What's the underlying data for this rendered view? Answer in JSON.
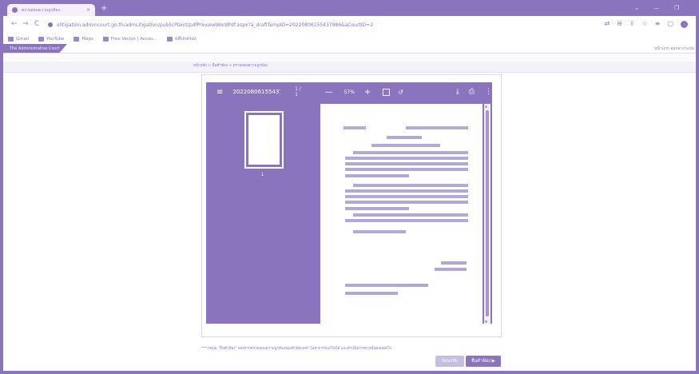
{
  "browser": {
    "tab_title": "ตรวจสอบความถูกต้อง",
    "tab_close": "×",
    "new_tab": "+",
    "minimize": "⌄",
    "min2": "—",
    "restore": "❐",
    "url": "elitigation.admincourt.go.th/admLitigation/publicPlaint/pdfPreviewWordPdf.aspx?a_draftTempID=20220806155437986&aCourtID=2",
    "back": "←",
    "forward": "→",
    "reload": "C",
    "icons": [
      "translate-icon",
      "zoom-icon",
      "share-icon",
      "star-icon",
      "reading-list-icon",
      "window-icon",
      "profile-icon"
    ]
  },
  "bookmarks": [
    {
      "label": "Gmail"
    },
    {
      "label": "YouTube"
    },
    {
      "label": "Maps"
    },
    {
      "label": "Free Vector | Accou..."
    },
    {
      "label": "คดีปกครอง"
    }
  ],
  "site": {
    "badge": "The Administrative Court",
    "right_links": "หน้าแรก  ออกจากระบบ"
  },
  "breadcrumb": "หน้าหลัก  >  ยื่นคำฟ้อง  >  ตรวจสอบความถูกต้อง",
  "viewer": {
    "filename": "20220806155437986...",
    "page_indicator": "1 / 1",
    "zoom": "57%",
    "thumb_page": "1",
    "menu_icon": "≡",
    "minus": "—",
    "plus": "+",
    "rotate": "↺",
    "download": "⤓",
    "print": "⎙",
    "more": "⋮",
    "arrow_up": "▲",
    "arrow_down": "▼"
  },
  "footer": {
    "note": "*** กดปุ่ม \"ยื่นคำฟ้อง\" หลังจากตรวจสอบความถูกต้องของคำฟ้องแล้ว ไม่สามารถแก้ไขได้ และดำเนินการตามขั้นตอนต่อไป",
    "back_label": "ย้อนกลับ",
    "next_label": "ยื่นคำฟ้อง ▶"
  },
  "colors": {
    "accent": "#8a74bd",
    "line": "#b4a8d8"
  }
}
